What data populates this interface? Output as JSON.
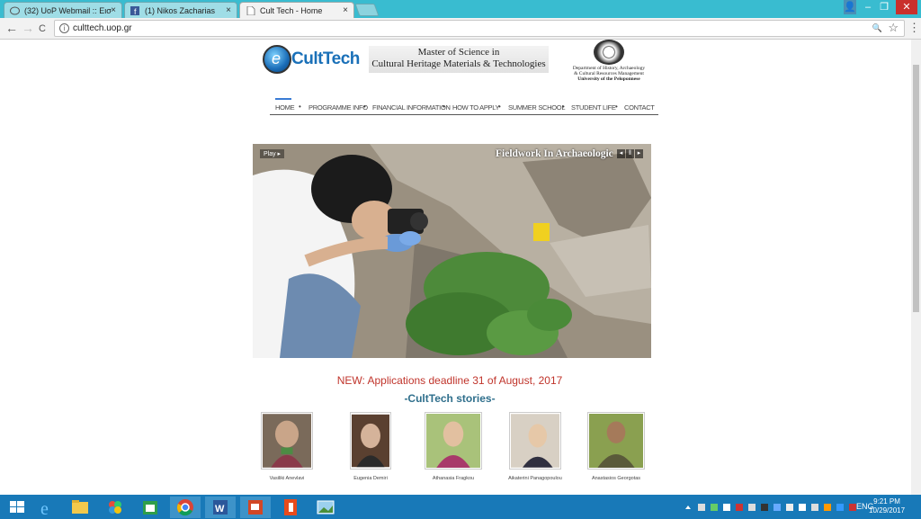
{
  "browser": {
    "tabs": [
      {
        "title": "(32) UoP Webmail :: Εισ",
        "icon": "mail-icon"
      },
      {
        "title": "(1) Nikos Zacharias",
        "icon": "facebook-icon"
      },
      {
        "title": "Cult Tech - Home",
        "icon": "page-icon"
      }
    ],
    "close_glyph": "×",
    "url": "culttech.uop.gr",
    "info_glyph": "i",
    "back_glyph": "←",
    "forward_glyph": "→",
    "reload_glyph": "C",
    "zoom_glyph": "🔍",
    "star_glyph": "☆",
    "menu_glyph": "⋮",
    "minimize_glyph": "–",
    "maximize_glyph": "❐",
    "close_window_glyph": "✕",
    "user_glyph": "👤"
  },
  "site": {
    "logo_text": "CultTech",
    "logo_letter": "e",
    "title_line1": "Master of Science in",
    "title_line2": "Cultural Heritage Materials & Technologies",
    "dept_line1": "Department of History, Archaeology",
    "dept_line2": "& Cultural Resources Management",
    "dept_line3": "University of the Peloponnese",
    "nav": [
      "HOME",
      "PROGRAMME INFO",
      "FINANCIAL INFORMATION",
      "HOW TO APPLY",
      "SUMMER SCHOOL",
      "STUDENT LIFE",
      "CONTACT"
    ],
    "nav_separator": "•",
    "slider": {
      "play_label": "Play ▸",
      "caption": "Fieldwork In Archaeologic",
      "prev": "◂",
      "pause": "‖",
      "next": "▸"
    },
    "announcement": "NEW:  Applications deadline 31 of August, 2017",
    "stories_title": "-CultTech stories-",
    "people": [
      "Vasiliki Anevlavi",
      "Eugenia Demiri",
      "Athanasia Fragkou",
      "Aikaterini Panagopoulou",
      "Anastasios Georgotas"
    ]
  },
  "taskbar": {
    "lang": "ENG",
    "time": "9:21 PM",
    "date": "10/29/2017",
    "apps": [
      "start-icon",
      "ie-icon",
      "file-explorer-icon",
      "paint-icon",
      "store-icon",
      "chrome-icon",
      "word-icon",
      "powerpoint-icon",
      "office-icon",
      "photo-viewer-icon"
    ]
  },
  "colors": {
    "tabstrip": "#39bcd0",
    "taskbar": "#1879b8",
    "announcement": "#c0342b",
    "stories": "#2f6f8c",
    "nav_active": "#3a7bd5"
  }
}
